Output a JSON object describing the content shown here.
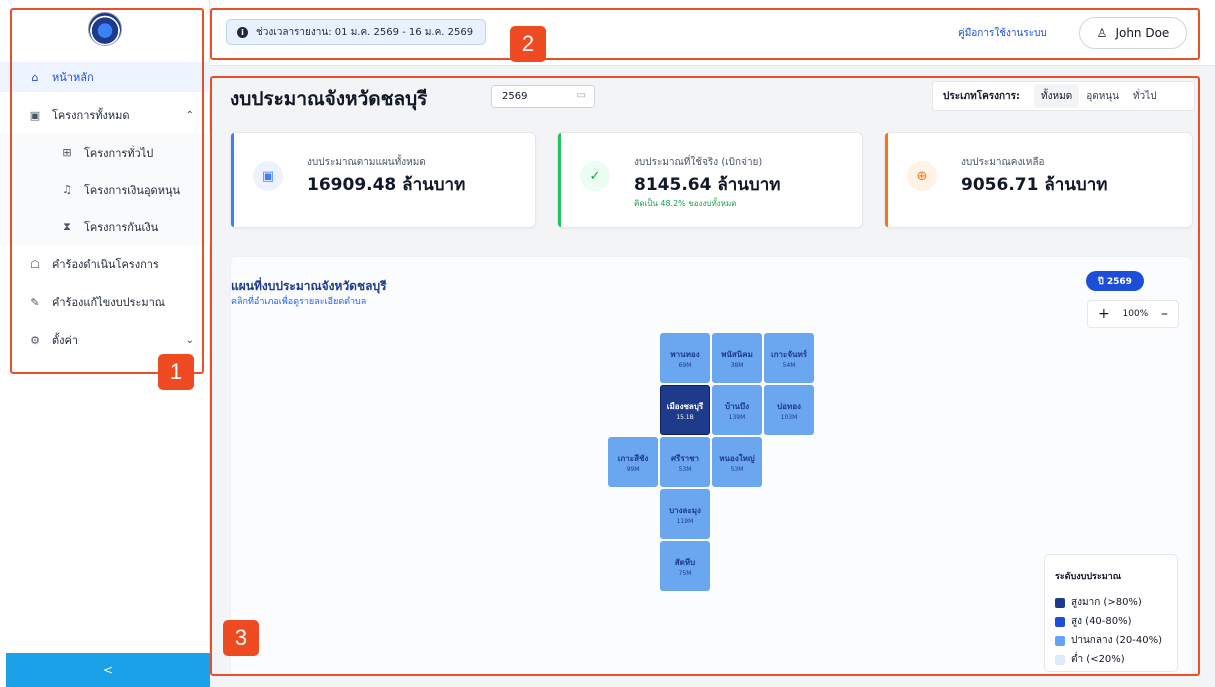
{
  "sidebar": {
    "items": [
      {
        "label": "หน้าหลัก",
        "icon": "home-icon",
        "active": true
      },
      {
        "label": "โครงการทั้งหมด",
        "icon": "projects-icon",
        "expanded": true,
        "children": [
          {
            "label": "โครงการทั่วไป",
            "icon": "grid-icon"
          },
          {
            "label": "โครงการเงินอุดหนุน",
            "icon": "bell-icon"
          },
          {
            "label": "โครงการกันเงิน",
            "icon": "hourglass-icon"
          }
        ]
      },
      {
        "label": "คำร้องดำเนินโครงการ",
        "icon": "request-icon"
      },
      {
        "label": "คำร้องแก้ไขงบประมาณ",
        "icon": "pencil-icon"
      },
      {
        "label": "ตั้งค่า",
        "icon": "gear-icon",
        "expanded": false
      }
    ],
    "collapse": "<"
  },
  "topbar": {
    "period": "ช่วงเวลารายงาน: 01 ม.ค. 2569 - 16 ม.ค. 2569",
    "manual": "คู่มือการใช้งานระบบ",
    "user": "John Doe"
  },
  "main": {
    "title": "งบประมาณจังหวัดชลบุรี",
    "year": "2569",
    "type_filter": {
      "label": "ประเภทโครงการ:",
      "options": [
        "ทั้งหมด",
        "อุดหนุน",
        "ทั่วไป"
      ],
      "selected": "ทั้งหมด"
    },
    "cards": [
      {
        "label": "งบประมาณตามแผนทั้งหมด",
        "value": "16909.48 ล้านบาท",
        "note": "",
        "color": "#3b82f6"
      },
      {
        "label": "งบประมาณที่ใช้จริง (เบิกจ่าย)",
        "value": "8145.64 ล้านบาท",
        "note": "คิดเป็น 48.2% ของงบทั้งหมด",
        "color": "#22c55e"
      },
      {
        "label": "งบประมาณคงเหลือ",
        "value": "9056.71 ล้านบาท",
        "note": "",
        "color": "#f97316"
      }
    ],
    "map": {
      "title": "แผนที่งบประมาณจังหวัดชลบุรี",
      "subtitle": "คลิกที่อำเภอเพื่อดูรายละเอียดตำบล",
      "year_badge": "ปี 2569",
      "zoom": "100%",
      "districts": [
        {
          "name": "พานทอง",
          "value": "69M",
          "level": "medium"
        },
        {
          "name": "พนัสนิคม",
          "value": "38M",
          "level": "medium"
        },
        {
          "name": "เกาะจันทร์",
          "value": "54M",
          "level": "medium"
        },
        {
          "name": "เมืองชลบุรี",
          "value": "15.1B",
          "level": "high"
        },
        {
          "name": "บ้านบึง",
          "value": "139M",
          "level": "medium"
        },
        {
          "name": "บ่อทอง",
          "value": "103M",
          "level": "medium"
        },
        {
          "name": "เกาะสีชัง",
          "value": "99M",
          "level": "medium"
        },
        {
          "name": "ศรีราชา",
          "value": "53M",
          "level": "medium"
        },
        {
          "name": "หนองใหญ่",
          "value": "53M",
          "level": "medium"
        },
        {
          "name": "บางละมุง",
          "value": "119M",
          "level": "medium"
        },
        {
          "name": "สัตหีบ",
          "value": "75M",
          "level": "medium"
        }
      ],
      "legend": {
        "title": "ระดับงบประมาณ",
        "items": [
          {
            "label": "สูงมาก (>80%)",
            "color": "#1e3a8a"
          },
          {
            "label": "สูง (40-80%)",
            "color": "#1d4ed8"
          },
          {
            "label": "ปานกลาง (20-40%)",
            "color": "#60a5fa"
          },
          {
            "label": "ต่ำ (<20%)",
            "color": "#dbeafe"
          }
        ]
      }
    }
  },
  "annotations": {
    "one": "1",
    "two": "2",
    "three": "3",
    "color": "#ef4b23"
  }
}
